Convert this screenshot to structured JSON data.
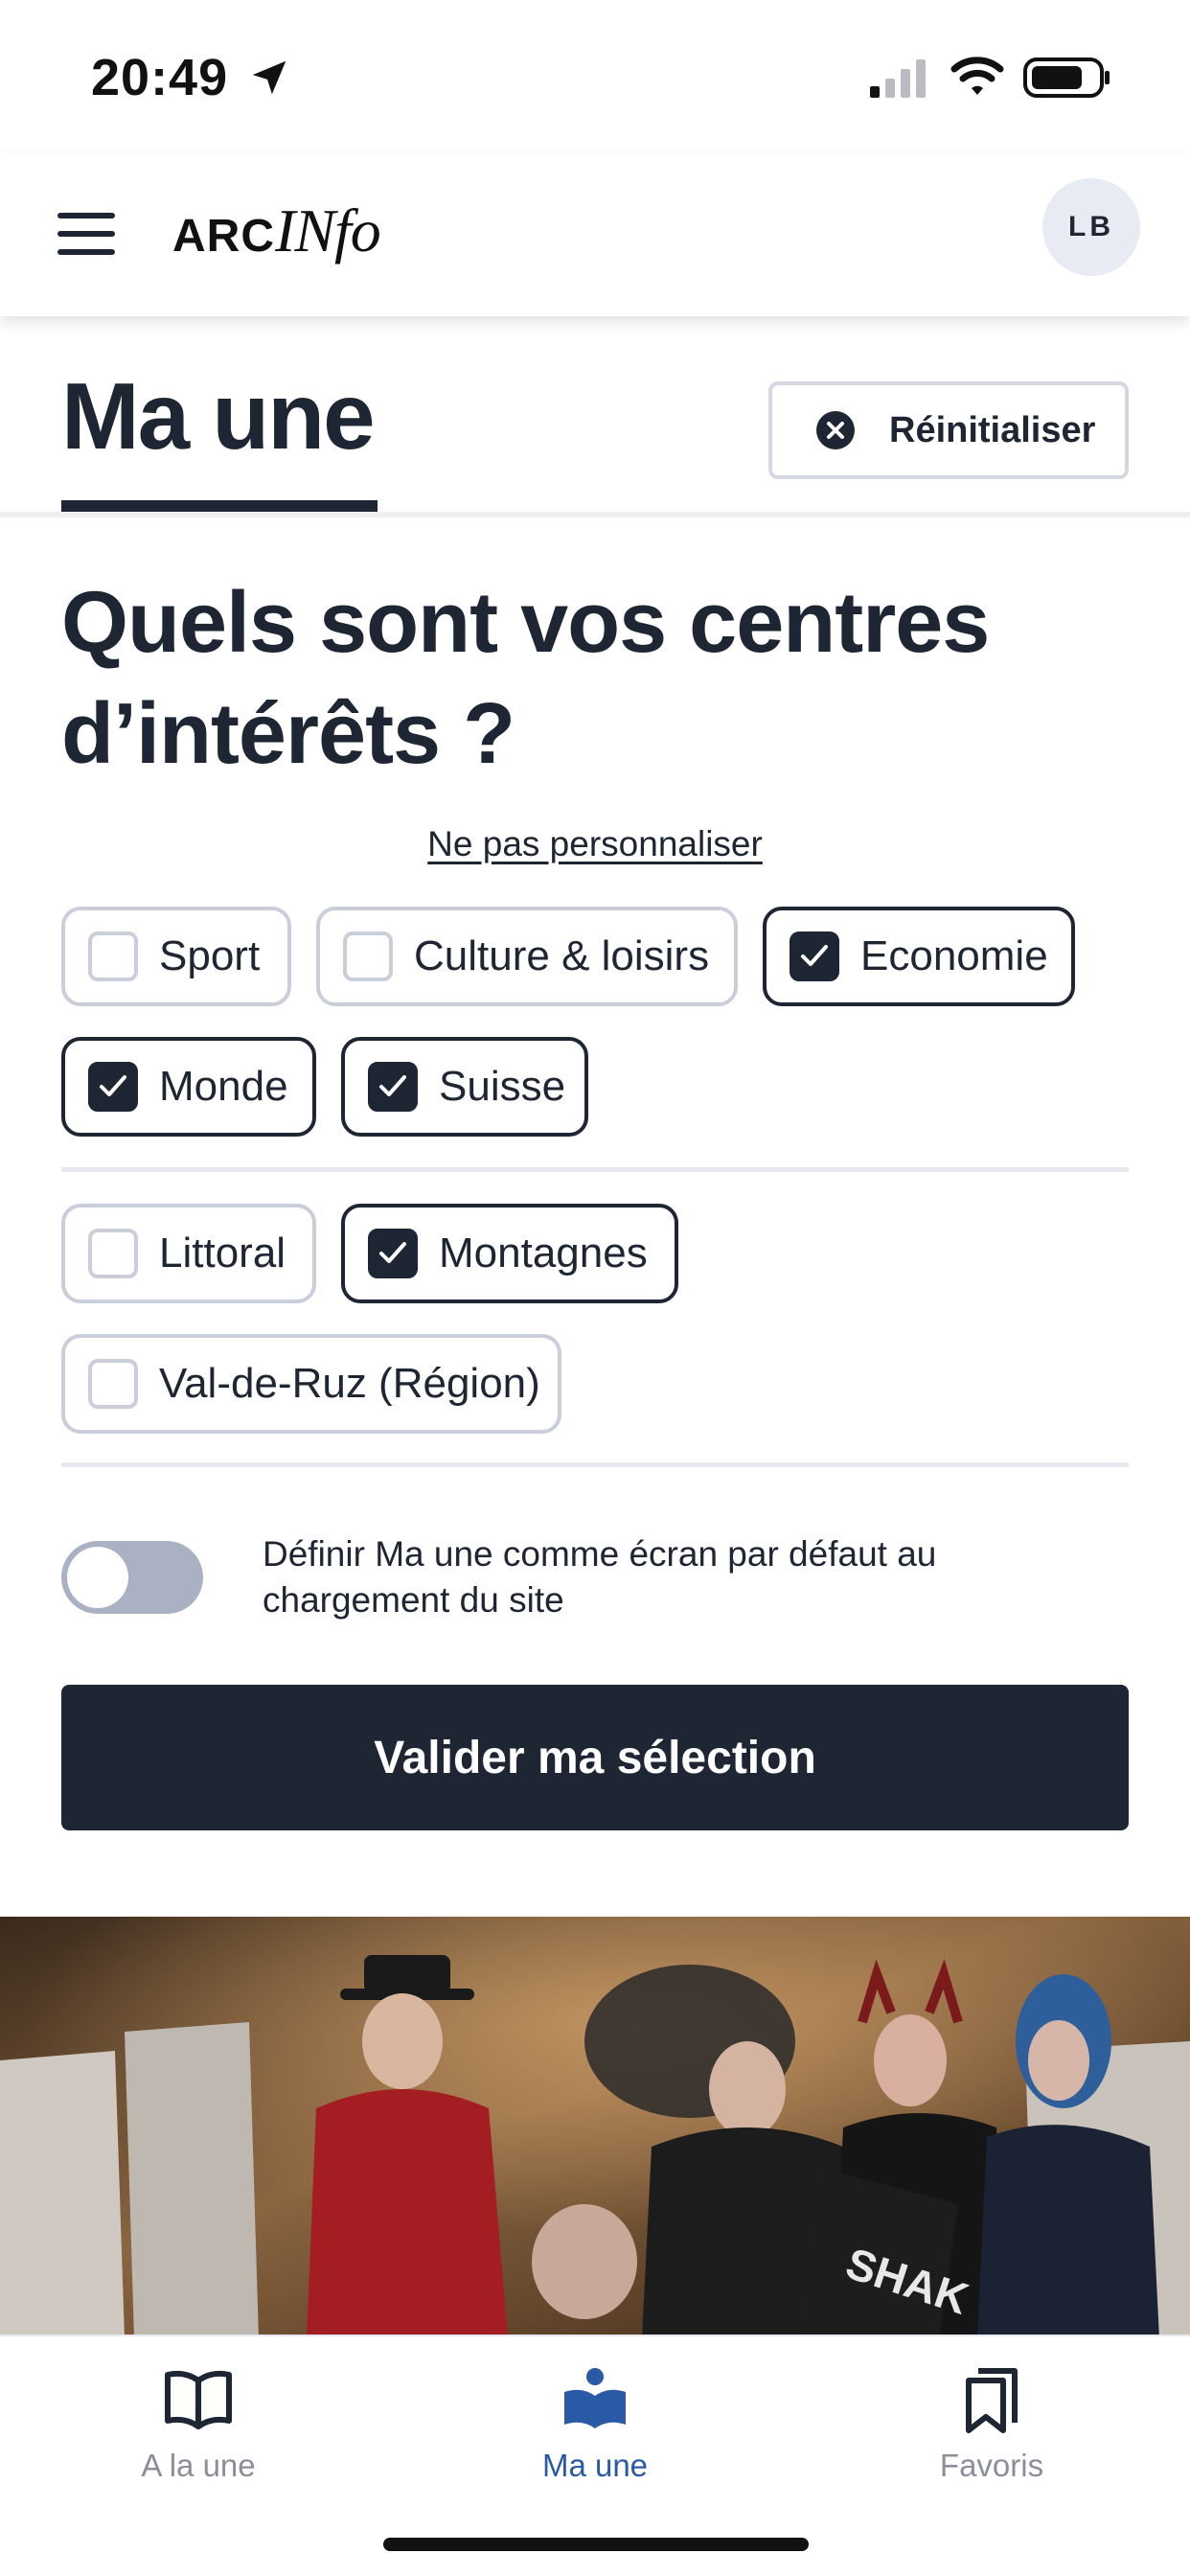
{
  "status_bar": {
    "time": "20:49",
    "icons": [
      "location-arrow-icon",
      "cellular-signal-icon",
      "wifi-icon",
      "battery-icon"
    ]
  },
  "header": {
    "logo_part1": "ARC",
    "logo_part2": "INfo",
    "avatar_initials": "LB",
    "menu_icon": "hamburger-menu-icon"
  },
  "page": {
    "title": "Ma une",
    "reset_label": "Réinitialiser",
    "reset_icon": "close-circle-icon"
  },
  "preferences": {
    "question": "Quels sont vos centres d’intérêts ?",
    "skip_link": "Ne pas personnaliser",
    "topics": [
      {
        "label": "Sport",
        "checked": false
      },
      {
        "label": "Culture & loisirs",
        "checked": false
      },
      {
        "label": "Economie",
        "checked": true
      },
      {
        "label": "Monde",
        "checked": true
      },
      {
        "label": "Suisse",
        "checked": true
      }
    ],
    "regions": [
      {
        "label": "Littoral",
        "checked": false
      },
      {
        "label": "Montagnes",
        "checked": true
      },
      {
        "label": "Val-de-Ruz (Région)",
        "checked": false
      }
    ],
    "default_toggle": {
      "label": "Définir Ma une comme écran par défaut au chargement du site",
      "on": false
    },
    "submit_label": "Valider ma sélection"
  },
  "photo": {
    "visible_text": "SHAK"
  },
  "bottom_nav": {
    "items": [
      {
        "label": "A la une",
        "icon": "open-book-icon",
        "active": false
      },
      {
        "label": "Ma une",
        "icon": "reader-book-icon",
        "active": true
      },
      {
        "label": "Favoris",
        "icon": "bookmarks-icon",
        "active": false
      }
    ]
  },
  "colors": {
    "primary": "#1e2533",
    "chip_border": "#c9ceda",
    "active_nav": "#2a5aa6",
    "inactive_nav": "#8a8f9a",
    "toggle_off": "#a9b1c2"
  }
}
